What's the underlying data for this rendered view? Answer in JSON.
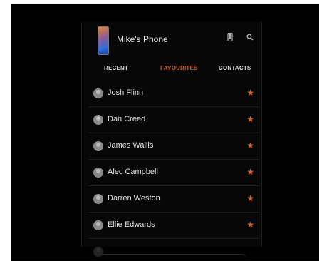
{
  "header": {
    "title": "Mike's Phone",
    "icons": [
      "phone-icon",
      "search-icon"
    ]
  },
  "tabs": [
    {
      "label": "RECENT",
      "active": false
    },
    {
      "label": "FAVOURITES",
      "active": true
    },
    {
      "label": "CONTACTS",
      "active": false
    }
  ],
  "contacts": [
    {
      "name": "Josh Flinn",
      "favourite": true
    },
    {
      "name": "Dan Creed",
      "favourite": true
    },
    {
      "name": "James Wallis",
      "favourite": true
    },
    {
      "name": "Alec Campbell",
      "favourite": true
    },
    {
      "name": "Darren Weston",
      "favourite": true
    },
    {
      "name": "Ellie Edwards",
      "favourite": true
    }
  ],
  "colors": {
    "accent": "#e0651e",
    "background": "#000000",
    "text": "#e4e4e4"
  }
}
